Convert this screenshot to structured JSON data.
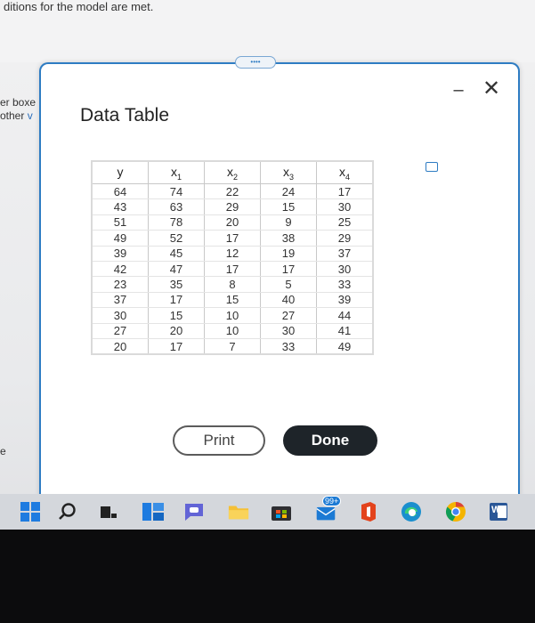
{
  "background": {
    "conditions_text": "ditions for the model are met.",
    "side_line1": "er boxe",
    "side_line2": "other ",
    "side_arrow": "v",
    "fragment_e": "e"
  },
  "modal": {
    "title": "Data Table",
    "minimize_glyph": "–",
    "close_glyph": "✕",
    "drag_glyph": "••••"
  },
  "table": {
    "headers": [
      {
        "main": "y",
        "sub": ""
      },
      {
        "main": "x",
        "sub": "1"
      },
      {
        "main": "x",
        "sub": "2"
      },
      {
        "main": "x",
        "sub": "3"
      },
      {
        "main": "x",
        "sub": "4"
      }
    ],
    "rows": [
      [
        "64",
        "74",
        "22",
        "24",
        "17"
      ],
      [
        "43",
        "63",
        "29",
        "15",
        "30"
      ],
      [
        "51",
        "78",
        "20",
        "9",
        "25"
      ],
      [
        "49",
        "52",
        "17",
        "38",
        "29"
      ],
      [
        "39",
        "45",
        "12",
        "19",
        "37"
      ],
      [
        "42",
        "47",
        "17",
        "17",
        "30"
      ],
      [
        "23",
        "35",
        "8",
        "5",
        "33"
      ],
      [
        "37",
        "17",
        "15",
        "40",
        "39"
      ],
      [
        "30",
        "15",
        "10",
        "27",
        "44"
      ],
      [
        "27",
        "20",
        "10",
        "30",
        "41"
      ],
      [
        "20",
        "17",
        "7",
        "33",
        "49"
      ]
    ]
  },
  "buttons": {
    "print": "Print",
    "done": "Done"
  },
  "taskbar": {
    "mail_badge": "99+",
    "word_letter": "W",
    "accent_colors": {
      "windows": "#1e7be0",
      "office": "#e3431c",
      "edge": "#1a8fce",
      "chrome": "#f4b400"
    }
  }
}
